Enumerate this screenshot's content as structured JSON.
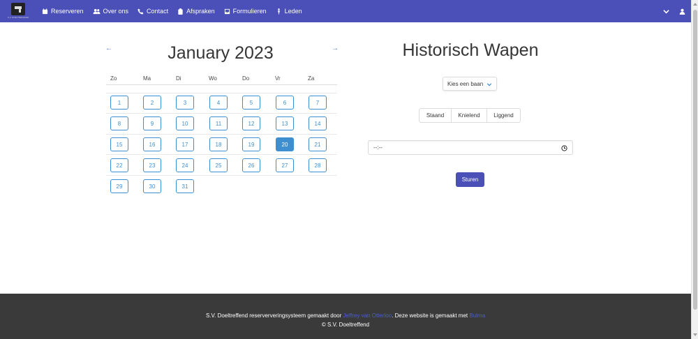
{
  "nav": {
    "logo_text": "S.V. DOELTREFFEND",
    "items": [
      {
        "label": "Reserveren",
        "icon": "calendar-icon"
      },
      {
        "label": "Over ons",
        "icon": "users-icon"
      },
      {
        "label": "Contact",
        "icon": "phone-icon"
      },
      {
        "label": "Afspraken",
        "icon": "clipboard-icon"
      },
      {
        "label": "Formulieren",
        "icon": "inbox-icon"
      },
      {
        "label": "Leden",
        "icon": "person-icon"
      }
    ]
  },
  "calendar": {
    "prev": "←",
    "next": "→",
    "title": "January 2023",
    "weekdays": [
      "Zo",
      "Ma",
      "Di",
      "Wo",
      "Do",
      "Vr",
      "Za"
    ],
    "days": [
      "1",
      "2",
      "3",
      "4",
      "5",
      "6",
      "7",
      "8",
      "9",
      "10",
      "11",
      "12",
      "13",
      "14",
      "15",
      "16",
      "17",
      "18",
      "19",
      "20",
      "21",
      "22",
      "23",
      "24",
      "25",
      "26",
      "27",
      "28",
      "29",
      "30",
      "31"
    ],
    "selected_day": "20",
    "selected_color": "#3e8ed0"
  },
  "form": {
    "title": "Historisch Wapen",
    "select_value": "Kies een baan",
    "tabs": [
      "Staand",
      "Knielend",
      "Liggend"
    ],
    "time_value": "--:--",
    "submit_label": "Sturen"
  },
  "footer": {
    "text_1": "S.V. Doeltreffend reserververingsysteem gemaakt door ",
    "author_link": "Jeffrey van Otterloo",
    "text_2": ". Deze website is gemaakt met ",
    "framework_link": "Bulma",
    "copyright": "© S.V. Doeltreffend"
  },
  "colors": {
    "navbar": "#4b4fb8",
    "accent": "#3e8ed0",
    "footer": "#3a3a3a"
  }
}
